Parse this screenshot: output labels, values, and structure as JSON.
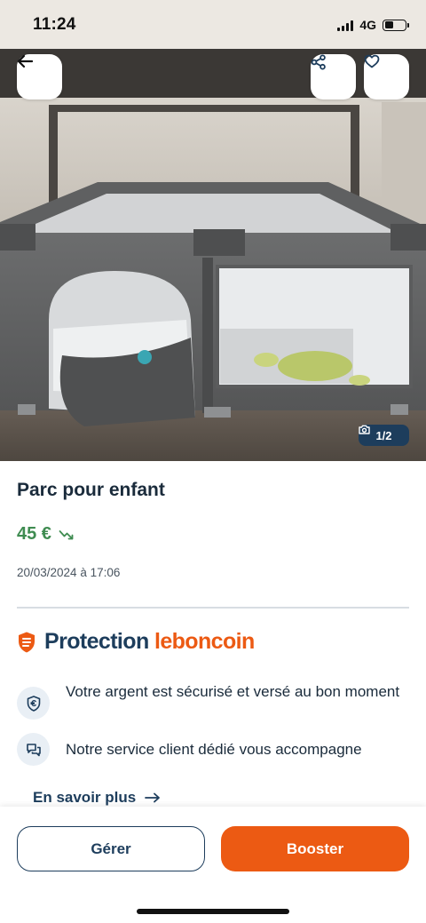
{
  "status_bar": {
    "time": "11:24",
    "network": "4G"
  },
  "listing": {
    "title": "Parc pour enfant",
    "price": "45 €",
    "date": "20/03/2024 à 17:06",
    "photo_counter": "1/2"
  },
  "protection": {
    "title_part1": "Protection",
    "title_part2": "leboncoin",
    "features": [
      {
        "icon": "shield-euro-icon",
        "text": "Votre argent est sécurisé et versé au bon moment"
      },
      {
        "icon": "chat-support-icon",
        "text": "Notre service client dédié vous accompagne"
      }
    ],
    "learn_more": "En savoir plus"
  },
  "actions": {
    "manage_label": "Gérer",
    "boost_label": "Booster"
  },
  "colors": {
    "brand_orange": "#ec5a13",
    "brand_navy": "#1d3d5c",
    "price_green": "#3f8c51"
  }
}
